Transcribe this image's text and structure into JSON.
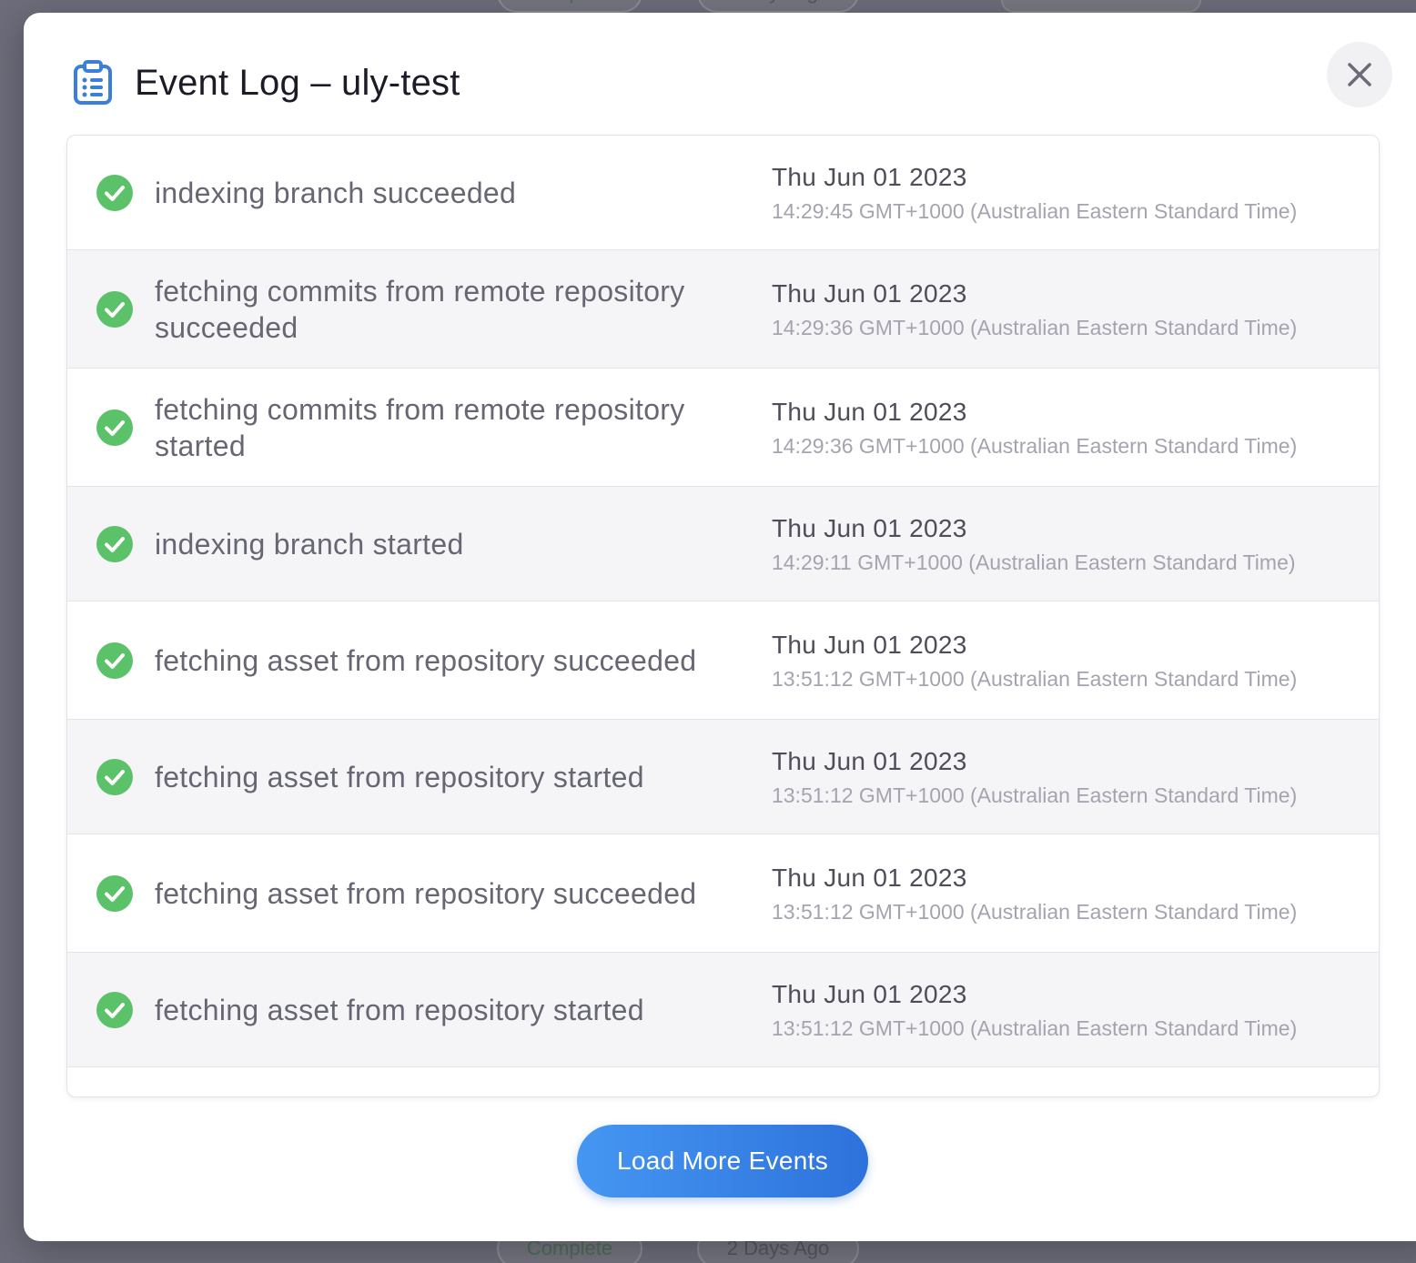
{
  "background": {
    "status_label": "Complete",
    "age_label": "2 Days Ago"
  },
  "modal": {
    "title": "Event Log – uly-test",
    "header_icon": "clipboard-list-icon",
    "close_icon": "close-icon",
    "load_more_label": "Load More Events"
  },
  "colors": {
    "success": "#5cc26a",
    "accent": "#3584e4",
    "header_icon": "#3a7fd8"
  },
  "events": [
    {
      "status": "success",
      "message": "indexing branch succeeded",
      "date": "Thu Jun 01 2023",
      "time": "14:29:45 GMT+1000 (Australian Eastern Standard Time)"
    },
    {
      "status": "success",
      "message": "fetching commits from remote repository succeeded",
      "date": "Thu Jun 01 2023",
      "time": "14:29:36 GMT+1000 (Australian Eastern Standard Time)"
    },
    {
      "status": "success",
      "message": "fetching commits from remote repository started",
      "date": "Thu Jun 01 2023",
      "time": "14:29:36 GMT+1000 (Australian Eastern Standard Time)"
    },
    {
      "status": "success",
      "message": "indexing branch started",
      "date": "Thu Jun 01 2023",
      "time": "14:29:11 GMT+1000 (Australian Eastern Standard Time)"
    },
    {
      "status": "success",
      "message": "fetching asset from repository succeeded",
      "date": "Thu Jun 01 2023",
      "time": "13:51:12 GMT+1000 (Australian Eastern Standard Time)"
    },
    {
      "status": "success",
      "message": "fetching asset from repository started",
      "date": "Thu Jun 01 2023",
      "time": "13:51:12 GMT+1000 (Australian Eastern Standard Time)"
    },
    {
      "status": "success",
      "message": "fetching asset from repository succeeded",
      "date": "Thu Jun 01 2023",
      "time": "13:51:12 GMT+1000 (Australian Eastern Standard Time)"
    },
    {
      "status": "success",
      "message": "fetching asset from repository started",
      "date": "Thu Jun 01 2023",
      "time": "13:51:12 GMT+1000 (Australian Eastern Standard Time)"
    }
  ]
}
